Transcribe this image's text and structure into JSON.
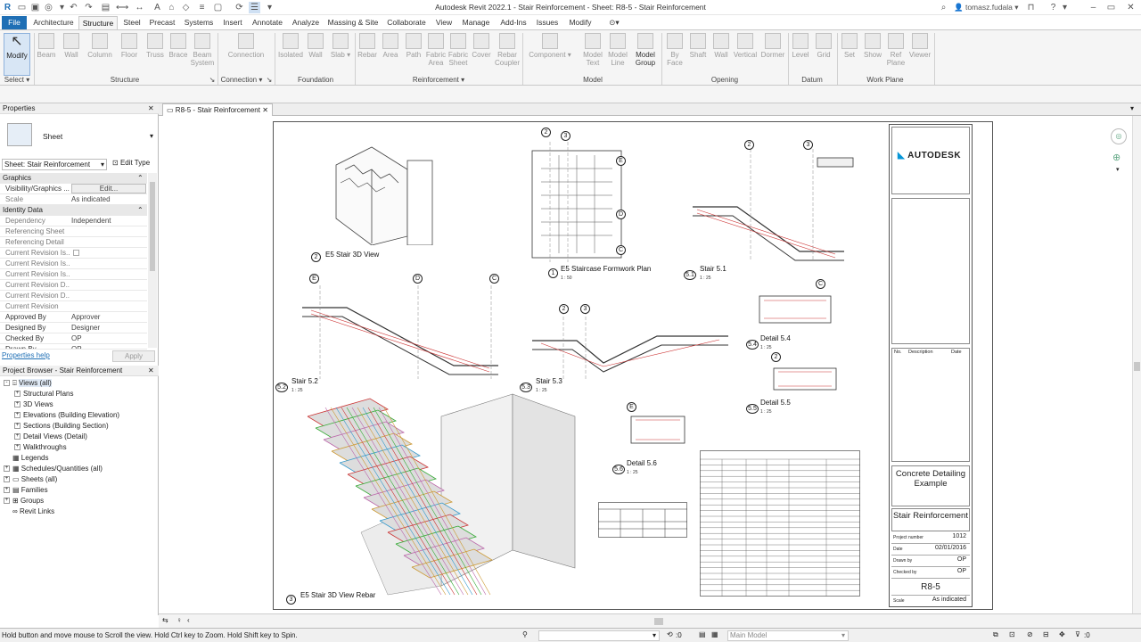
{
  "window": {
    "title": "Autodesk Revit 2022.1 - Stair Reinforcement - Sheet: R8-5 - Stair Reinforcement",
    "user": "tomasz.fudala"
  },
  "tabs": [
    "File",
    "Architecture",
    "Structure",
    "Steel",
    "Precast",
    "Systems",
    "Insert",
    "Annotate",
    "Analyze",
    "Massing & Site",
    "Collaborate",
    "View",
    "Manage",
    "Add-Ins",
    "Issues",
    "Modify"
  ],
  "active_tab": "Structure",
  "ribbon": {
    "select": {
      "button": "Modify",
      "panel": "Select"
    },
    "structure": {
      "buttons": [
        "Beam",
        "Wall",
        "Column",
        "Floor",
        "Truss",
        "Brace",
        "Beam System"
      ],
      "panel": "Structure"
    },
    "connection": {
      "buttons": [
        "Connection"
      ],
      "panel": "Connection"
    },
    "foundation": {
      "buttons": [
        "Isolated",
        "Wall",
        "Slab"
      ],
      "panel": "Foundation"
    },
    "reinforcement": {
      "buttons": [
        "Rebar",
        "Area",
        "Path",
        "Fabric Area",
        "Fabric Sheet",
        "Cover",
        "Rebar Coupler"
      ],
      "panel": "Reinforcement"
    },
    "model": {
      "buttons": [
        "Component",
        "Model Text",
        "Model Line",
        "Model Group"
      ],
      "panel": "Model"
    },
    "opening": {
      "buttons": [
        "By Face",
        "Shaft",
        "Wall",
        "Vertical",
        "Dormer"
      ],
      "panel": "Opening"
    },
    "datum": {
      "buttons": [
        "Level",
        "Grid"
      ],
      "panel": "Datum"
    },
    "workplane": {
      "buttons": [
        "Set",
        "Show",
        "Ref Plane",
        "Viewer"
      ],
      "panel": "Work Plane"
    }
  },
  "properties": {
    "header": "Properties",
    "type_name": "Sheet",
    "selector": "Sheet: Stair Reinforcement",
    "edit_type": "Edit Type",
    "groups": {
      "graphics": "Graphics",
      "identity": "Identity Data"
    },
    "rows": [
      {
        "key": "Visibility/Graphics ...",
        "value": "Edit...",
        "muted": false
      },
      {
        "key": "Scale",
        "value": "As indicated",
        "muted": true
      },
      {
        "key": "Dependency",
        "value": "Independent",
        "muted": true
      },
      {
        "key": "Referencing Sheet",
        "value": "",
        "muted": true
      },
      {
        "key": "Referencing Detail",
        "value": "",
        "muted": true
      },
      {
        "key": "Current Revision Is...",
        "value": "",
        "muted": true
      },
      {
        "key": "Current Revision Is...",
        "value": "",
        "muted": true
      },
      {
        "key": "Current Revision Is...",
        "value": "",
        "muted": true
      },
      {
        "key": "Current Revision D...",
        "value": "",
        "muted": true
      },
      {
        "key": "Current Revision D...",
        "value": "",
        "muted": true
      },
      {
        "key": "Current Revision",
        "value": "",
        "muted": true
      },
      {
        "key": "Approved By",
        "value": "Approver",
        "muted": false
      },
      {
        "key": "Designed By",
        "value": "Designer",
        "muted": false
      },
      {
        "key": "Checked By",
        "value": "OP",
        "muted": false
      },
      {
        "key": "Drawn By",
        "value": "OP",
        "muted": false
      }
    ],
    "help": "Properties help",
    "apply": "Apply"
  },
  "browser": {
    "header": "Project Browser - Stair Reinforcement",
    "items": [
      {
        "label": "Views (all)",
        "level": 0,
        "expand": "-"
      },
      {
        "label": "Structural Plans",
        "level": 1,
        "expand": "+"
      },
      {
        "label": "3D Views",
        "level": 1,
        "expand": "+"
      },
      {
        "label": "Elevations (Building Elevation)",
        "level": 1,
        "expand": "+"
      },
      {
        "label": "Sections (Building Section)",
        "level": 1,
        "expand": "+"
      },
      {
        "label": "Detail Views (Detail)",
        "level": 1,
        "expand": "+"
      },
      {
        "label": "Walkthroughs",
        "level": 1,
        "expand": "+"
      },
      {
        "label": "Legends",
        "level": 0,
        "expand": ""
      },
      {
        "label": "Schedules/Quantities (all)",
        "level": 0,
        "expand": "+"
      },
      {
        "label": "Sheets (all)",
        "level": 0,
        "expand": "+"
      },
      {
        "label": "Families",
        "level": 0,
        "expand": "+"
      },
      {
        "label": "Groups",
        "level": 0,
        "expand": "+"
      },
      {
        "label": "Revit Links",
        "level": 0,
        "expand": ""
      }
    ]
  },
  "view_tab": "R8-5 - Stair Reinforcement",
  "sheet": {
    "views": [
      {
        "num": "2",
        "title": "E5 Stair 3D View"
      },
      {
        "num": "1",
        "title": "E5 Staircase Formwork Plan",
        "scale": "1 : 50"
      },
      {
        "num": "5.1",
        "title": "Stair 5.1",
        "scale": "1 : 25"
      },
      {
        "num": "5.2",
        "title": "Stair 5.2",
        "scale": "1 : 25"
      },
      {
        "num": "5.3",
        "title": "Stair 5.3",
        "scale": "1 : 25"
      },
      {
        "num": "5.4",
        "title": "Detail 5.4",
        "scale": "1 : 25"
      },
      {
        "num": "5.5",
        "title": "Detail 5.5",
        "scale": "1 : 25"
      },
      {
        "num": "5.6",
        "title": "Detail 5.6",
        "scale": "1 : 25"
      },
      {
        "num": "3",
        "title": "E5 Stair 3D View Rebar"
      }
    ],
    "grid_bubbles": [
      "2",
      "3",
      "E",
      "D",
      "C"
    ],
    "titleblock": {
      "logo": "AUTODESK",
      "project_name": "Concrete Detailing Example",
      "sheet_name": "Stair Reinforcement",
      "project_number_label": "Project number",
      "project_number": "1012",
      "date_label": "Date",
      "date": "02/01/2016",
      "drawn_by_label": "Drawn by",
      "drawn_by": "OP",
      "checked_by_label": "Checked by",
      "checked_by": "OP",
      "sheet_number": "R8-5",
      "scale_label": "Scale",
      "scale": "As indicated",
      "rev_headers": [
        "No.",
        "Description",
        "Date"
      ]
    }
  },
  "status": {
    "hint": "Hold button and move mouse to Scroll the view. Hold Ctrl key to Zoom. Hold Shift key to Spin.",
    "zero": ":0",
    "model": "Main Model",
    "filter": ":0"
  },
  "colors": {
    "accent": "#1f6fb5",
    "ribbon_bg": "#f5f5f5",
    "modify_bg": "#d8e6f5"
  }
}
